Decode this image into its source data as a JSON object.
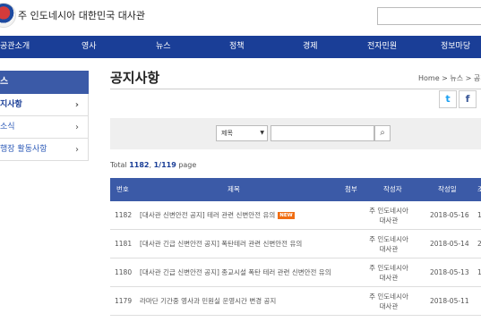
{
  "header": {
    "title": "주 인도네시아 대한민국 대사관"
  },
  "nav": [
    "공관소개",
    "영사",
    "뉴스",
    "정책",
    "경제",
    "전자민원",
    "정보마당"
  ],
  "sidebar": {
    "heading": "스",
    "items": [
      {
        "label": "지사항"
      },
      {
        "label": "소식"
      },
      {
        "label": "행장 활동사항"
      }
    ]
  },
  "content": {
    "title": "공지사항",
    "breadcrumb": "Home > 뉴스 > 공지",
    "social": {
      "twitter": "twitter-icon",
      "facebook": "facebook-icon"
    },
    "search": {
      "select_value": "제목"
    },
    "total": {
      "prefix": "Total ",
      "count": "1182",
      "sep": ", ",
      "page": "1/119",
      "suffix": " page"
    },
    "columns": {
      "no": "번호",
      "subject": "제목",
      "file": "첨부",
      "author": "작성자",
      "date": "작성일",
      "hits": "조"
    },
    "rows": [
      {
        "no": "1182",
        "subject": "[대사관 신변안전 공지] 테러 관련 신변안전 유의",
        "new": "NEW",
        "author": "주 인도네시아 대사관",
        "date": "2018-05-16",
        "hits": "1"
      },
      {
        "no": "1181",
        "subject": "[대사관 긴급 신변안전 공지] 폭탄테러 관련 신변안전 유의",
        "author": "주 인도네시아 대사관",
        "date": "2018-05-14",
        "hits": "2"
      },
      {
        "no": "1180",
        "subject": "[대사관 긴급 신변안전 공지] 종교시설 폭탄 테러 관련 신변안전 유의",
        "author": "주 인도네시아 대사관",
        "date": "2018-05-13",
        "hits": "1"
      },
      {
        "no": "1179",
        "subject": "라마단 기간중 영사과 민원실 운영시간 변경 공지",
        "author": "주 인도네시아 대사관",
        "date": "2018-05-11",
        "hits": ""
      }
    ]
  }
}
